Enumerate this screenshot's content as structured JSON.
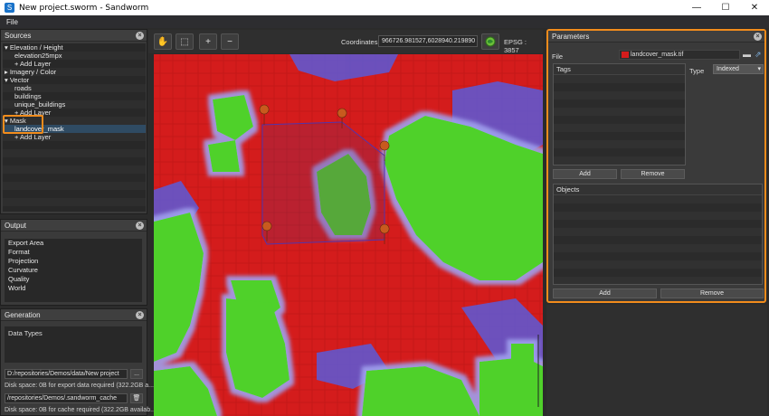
{
  "window": {
    "title": "New project.sworm - Sandworm",
    "min": "—",
    "max": "☐",
    "close": "✕"
  },
  "menu": {
    "file": "File"
  },
  "sources": {
    "title": "Sources",
    "items": [
      {
        "label": "▾ Elevation / Height",
        "indent": 0
      },
      {
        "label": "elevation25mpx",
        "indent": 1
      },
      {
        "label": "+ Add Layer",
        "indent": 1
      },
      {
        "label": "▸ Imagery / Color",
        "indent": 0
      },
      {
        "label": "▾ Vector",
        "indent": 0
      },
      {
        "label": "roads",
        "indent": 1
      },
      {
        "label": "buildings",
        "indent": 1
      },
      {
        "label": "unique_buildings",
        "indent": 1
      },
      {
        "label": "+ Add Layer",
        "indent": 1
      },
      {
        "label": "▾ Mask",
        "indent": 0
      },
      {
        "label": "landcover_mask",
        "indent": 1,
        "selected": true
      },
      {
        "label": "+ Add Layer",
        "indent": 1
      }
    ]
  },
  "output": {
    "title": "Output",
    "items": [
      "Export Area",
      "Format",
      "Projection",
      "Curvature",
      "Quality",
      "World"
    ]
  },
  "generation": {
    "title": "Generation",
    "data_types": "Data Types",
    "export_path": "D:/repositories/Demos/data/New project",
    "browse": "...",
    "export_disk": "Disk space: 0B for export data required (322.2GB a...",
    "cache_path": "/repositories/Demos/.sandworm_cache",
    "cache_disk": "Disk space: 0B for cache required (322.2GB availab..."
  },
  "toolbar": {
    "pan_icon": "hand-icon",
    "select_icon": "select-icon",
    "zoom_in": "+",
    "zoom_out": "−",
    "coordinates_label": "Coordinates:",
    "coordinates_value": "966726.981527,6028940.219890",
    "epsg": "EPSG : 3857"
  },
  "parameters": {
    "title": "Parameters",
    "file_label": "File",
    "file_value": "landcover_mask.tif",
    "tags_header": "Tags",
    "type_label": "Type",
    "type_value": "Indexed",
    "add": "Add",
    "remove": "Remove",
    "objects_header": "Objects",
    "add2": "Add",
    "remove2": "Remove"
  },
  "colors": {
    "accent": "#f28c1c",
    "mask_red": "#d41c1c",
    "mask_green": "#4fd12a",
    "mask_blue": "#5a5ad8"
  }
}
